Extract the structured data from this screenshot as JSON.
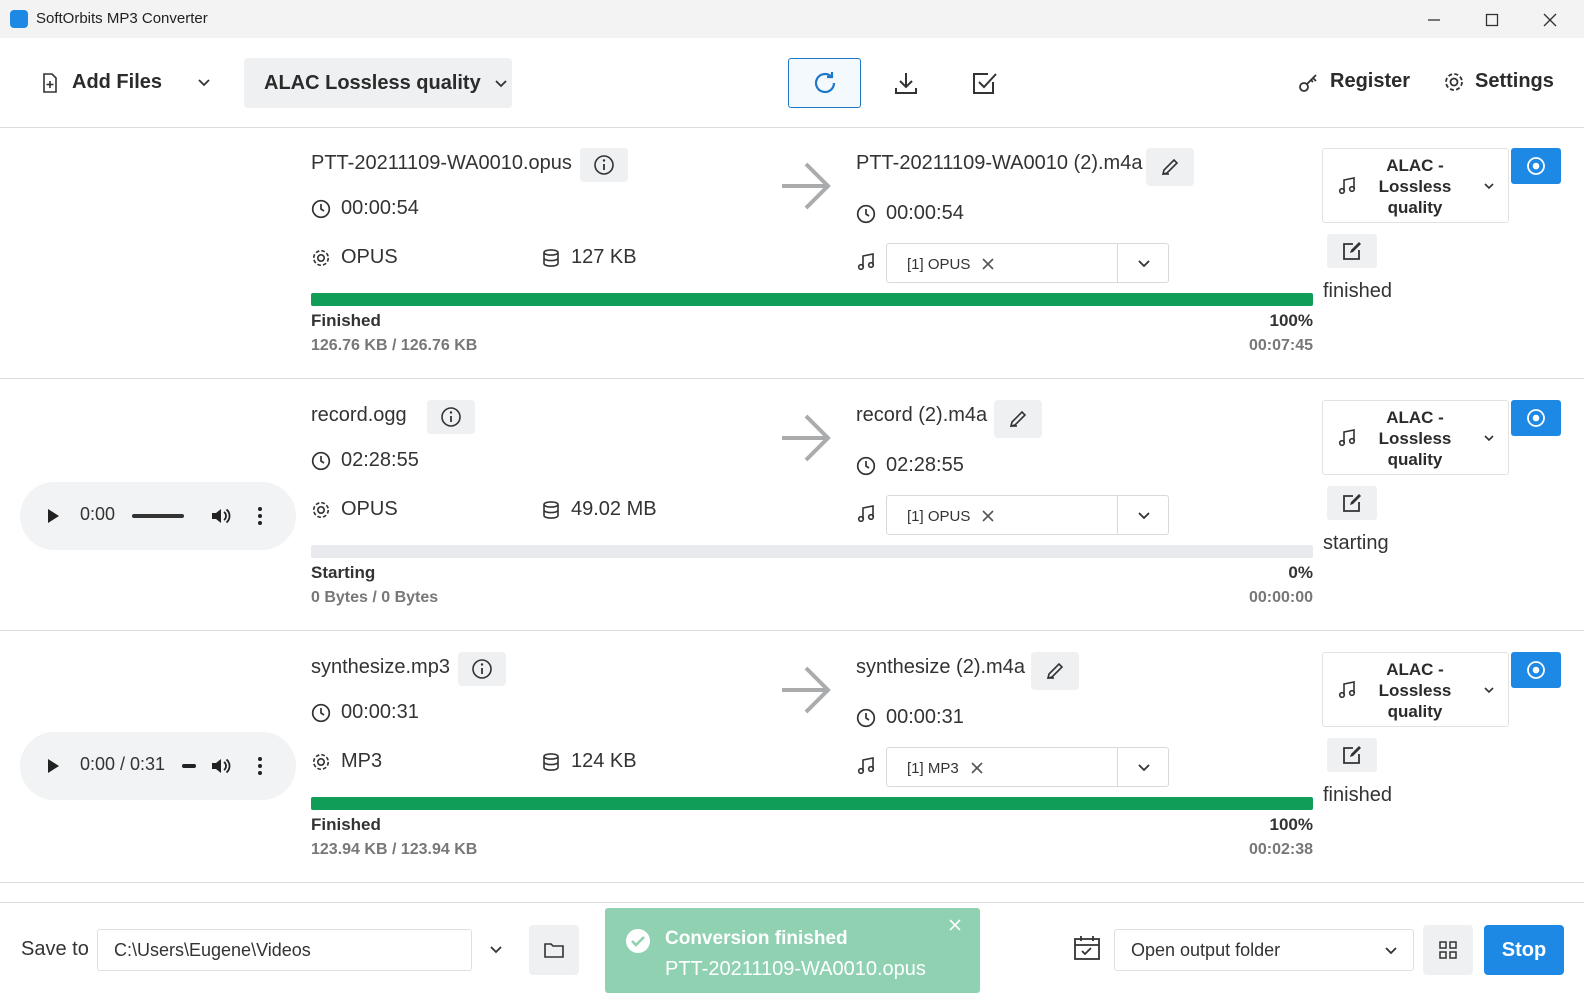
{
  "window": {
    "title": "SoftOrbits MP3 Converter"
  },
  "toolbar": {
    "add_files_label": "Add Files",
    "quality_label": "ALAC Lossless quality",
    "register_label": "Register",
    "settings_label": "Settings"
  },
  "rows": [
    {
      "source_name": "PTT-20211109-WA0010.opus",
      "source_duration": "00:00:54",
      "source_format": "OPUS",
      "source_size": "127 KB",
      "output_name": "PTT-20211109-WA0010 (2).m4a",
      "output_duration": "00:00:54",
      "stream_chip": "[1] OPUS",
      "progress_percent": 100,
      "status_label": "Finished",
      "size_progress": "126.76 KB / 126.76 KB",
      "percent_label": "100%",
      "elapsed": "00:07:45",
      "preset_label": "ALAC - Lossless quality",
      "row_status": "finished"
    },
    {
      "source_name": "record.ogg",
      "source_duration": "02:28:55",
      "source_format": "OPUS",
      "source_size": "49.02 MB",
      "output_name": "record (2).m4a",
      "output_duration": "02:28:55",
      "stream_chip": "[1] OPUS",
      "progress_percent": 0,
      "status_label": "Starting",
      "size_progress": "0 Bytes / 0 Bytes",
      "percent_label": "0%",
      "elapsed": "00:00:00",
      "preset_label": "ALAC - Lossless quality",
      "row_status": "starting",
      "player_time": "0:00"
    },
    {
      "source_name": "synthesize.mp3",
      "source_duration": "00:00:31",
      "source_format": "MP3",
      "source_size": "124 KB",
      "output_name": "synthesize (2).m4a",
      "output_duration": "00:00:31",
      "stream_chip": "[1] MP3",
      "progress_percent": 100,
      "status_label": "Finished",
      "size_progress": "123.94 KB / 123.94 KB",
      "percent_label": "100%",
      "elapsed": "00:02:38",
      "preset_label": "ALAC - Lossless quality",
      "row_status": "finished",
      "player_time": "0:00 / 0:31"
    }
  ],
  "footer": {
    "save_to_label": "Save to",
    "save_path": "C:\\Users\\Eugene\\Videos",
    "toast_title": "Conversion finished",
    "toast_file": "PTT-20211109-WA0010.opus",
    "after_action": "Open output folder",
    "stop_label": "Stop"
  },
  "colors": {
    "accent": "#1e88e5",
    "progress": "#0f9d58",
    "toast": "#8fd1b1"
  }
}
